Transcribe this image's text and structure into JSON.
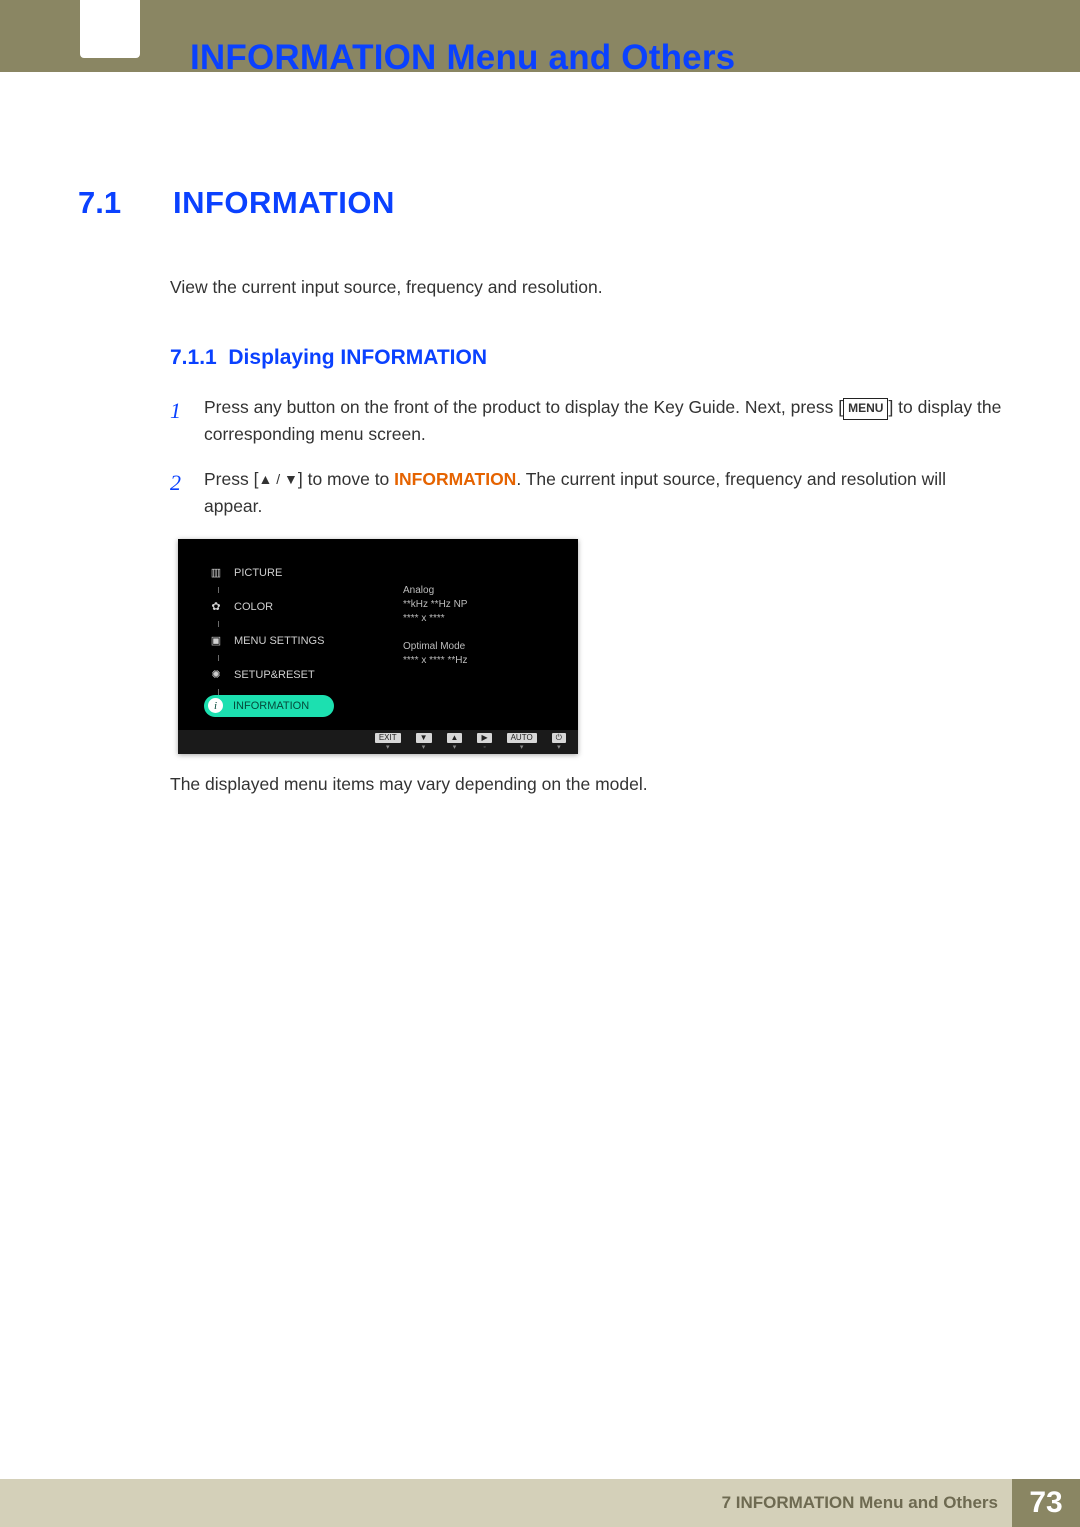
{
  "header": {
    "chapter_title": "INFORMATION Menu and Others"
  },
  "section": {
    "number": "7.1",
    "title": "INFORMATION",
    "intro": "View the current input source, frequency and resolution.",
    "subsection": {
      "number": "7.1.1",
      "title": "Displaying INFORMATION"
    },
    "steps": {
      "s1": {
        "num": "1",
        "part_a": "Press any button on the front of the product to display the Key Guide. Next, press [",
        "key": "MENU",
        "part_b": "] to display the corresponding menu screen."
      },
      "s2": {
        "num": "2",
        "part_a": "Press [",
        "arrows": "▲ / ▼",
        "part_b": "] to move to ",
        "keyword": "INFORMATION",
        "part_c": ". The current input source, frequency and resolution will appear."
      }
    },
    "note": "The displayed menu items may vary depending on the model."
  },
  "osd": {
    "menu": {
      "picture": "PICTURE",
      "color": "COLOR",
      "menu_settings": "MENU SETTINGS",
      "setup_reset": "SETUP&RESET",
      "information": "INFORMATION"
    },
    "right": {
      "line1": "Analog",
      "line2": "**kHz **Hz NP",
      "line3": "**** x ****",
      "line4": "Optimal Mode",
      "line5": "**** x ****  **Hz"
    },
    "nav": {
      "exit": "EXIT",
      "down": "▼",
      "up": "▲",
      "right": "▶",
      "auto": "AUTO",
      "power": "⏻"
    }
  },
  "footer": {
    "label": "7 INFORMATION Menu and Others",
    "page": "73"
  }
}
